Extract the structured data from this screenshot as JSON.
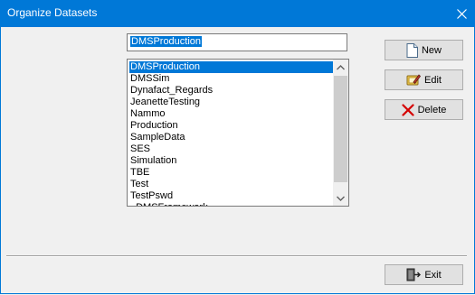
{
  "window": {
    "title": "Organize Datasets"
  },
  "name_field": {
    "value": "DMSProduction"
  },
  "list": {
    "items": [
      "DMSProduction",
      "DMSSim",
      "Dynafact_Regards",
      "JeanetteTesting",
      "Nammo",
      "Production",
      "SampleData",
      "SES",
      "Simulation",
      "TBE",
      "Test",
      "TestPswd",
      "_DMSFramework"
    ],
    "selected_index": 0
  },
  "buttons": {
    "new": "New",
    "edit": "Edit",
    "delete": "Delete",
    "exit": "Exit"
  },
  "icons": {
    "close": "close-icon",
    "new": "new-document-icon",
    "edit": "edit-icon",
    "delete": "delete-x-icon",
    "exit": "exit-door-icon"
  },
  "colors": {
    "title_bar": "#0078d7",
    "selection": "#0078d7",
    "delete_icon": "#d40000"
  }
}
